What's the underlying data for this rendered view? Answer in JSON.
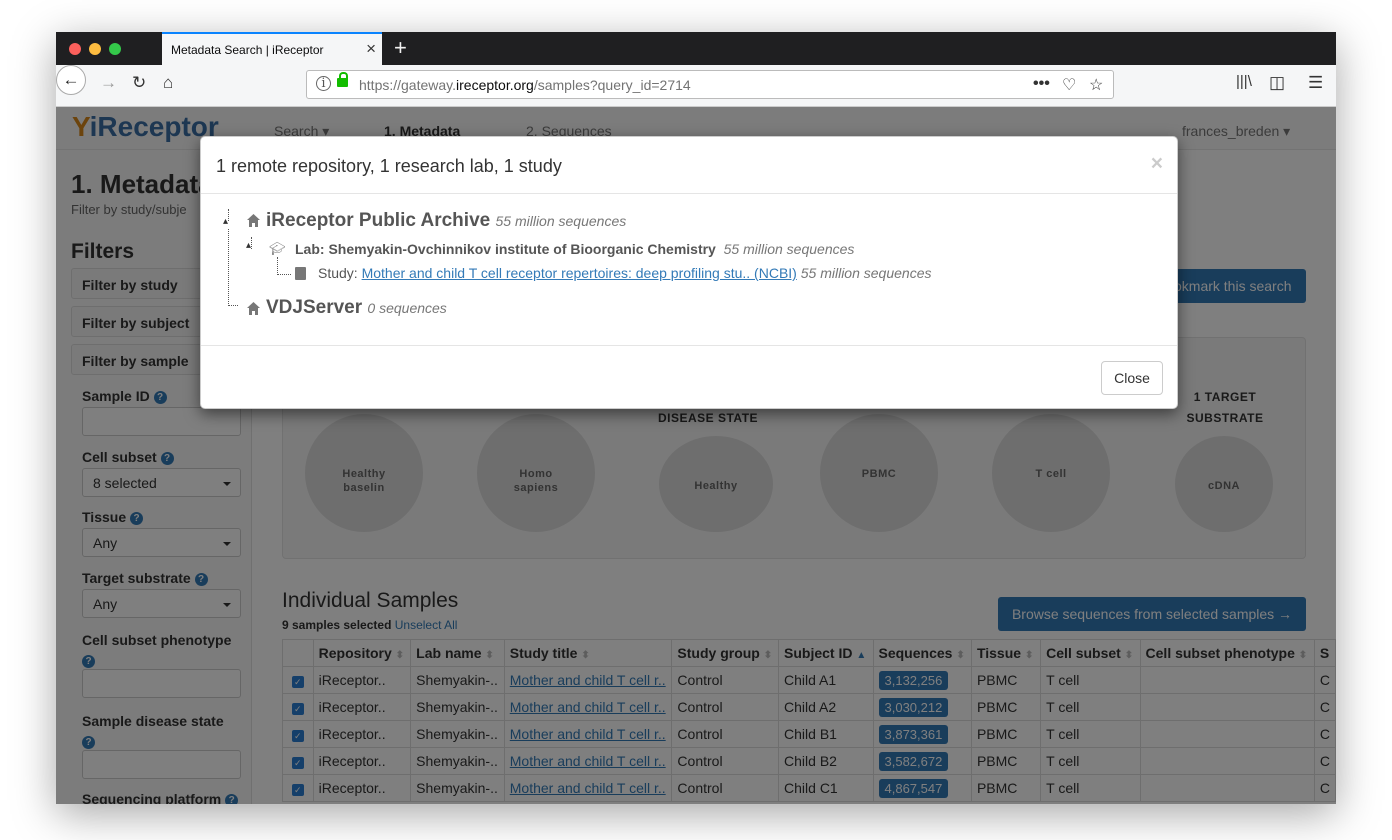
{
  "browser": {
    "tab_title": "Metadata Search | iReceptor",
    "url_prefix": "https://gateway.",
    "url_domain": "ireceptor.org",
    "url_path": "/samples?query_id=2714"
  },
  "site": {
    "logo_text": "iReceptor",
    "nav": {
      "search": "Search",
      "metadata": "1. Metadata",
      "sequences": "2. Sequences",
      "user": "frances_breden"
    },
    "page_title": "1. Metadata",
    "page_subtitle": "Filter by study/subje",
    "bookmark_button": "okmark this search"
  },
  "sidebar": {
    "heading": "Filters",
    "groups": [
      "Filter by study",
      "Filter by subject",
      "Filter by sample"
    ],
    "fields": {
      "sample_id": "Sample ID",
      "cell_subset": "Cell subset",
      "cell_subset_value": "8 selected",
      "tissue": "Tissue",
      "tissue_value": "Any",
      "target_substrate": "Target substrate",
      "target_substrate_value": "Any",
      "cell_subset_phenotype": "Cell subset phenotype",
      "sample_disease_state": "Sample disease state",
      "sequencing_platform": "Sequencing platform"
    }
  },
  "stats": {
    "headers": {
      "disease_state": "DISEASE STATE",
      "target_substrate_1": "1 TARGET",
      "target_substrate_2": "SUBSTRATE"
    },
    "bubbles": [
      {
        "line1": "Healthy",
        "line2": "baselin"
      },
      {
        "line1": "Homo",
        "line2": "sapiens"
      },
      {
        "line1": "Healthy",
        "line2": ""
      },
      {
        "line1": "PBMC",
        "line2": ""
      },
      {
        "line1": "T cell",
        "line2": ""
      },
      {
        "line1": "cDNA",
        "line2": ""
      }
    ]
  },
  "samples": {
    "heading": "Individual Samples",
    "selected_text": "9 samples selected",
    "unselect_all": "Unselect All",
    "browse_button": "Browse sequences from selected samples →",
    "columns": [
      "Repository",
      "Lab name",
      "Study title",
      "Study group",
      "Subject ID",
      "Sequences",
      "Tissue",
      "Cell subset",
      "Cell subset phenotype",
      "S"
    ],
    "rows": [
      {
        "repository": "iReceptor..",
        "lab": "Shemyakin-..",
        "study": "Mother and child T cell r..",
        "group": "Control",
        "subject": "Child A1",
        "sequences": "3,132,256",
        "tissue": "PBMC",
        "cell_subset": "T cell",
        "phenotype": "",
        "s": "C"
      },
      {
        "repository": "iReceptor..",
        "lab": "Shemyakin-..",
        "study": "Mother and child T cell r..",
        "group": "Control",
        "subject": "Child A2",
        "sequences": "3,030,212",
        "tissue": "PBMC",
        "cell_subset": "T cell",
        "phenotype": "",
        "s": "C"
      },
      {
        "repository": "iReceptor..",
        "lab": "Shemyakin-..",
        "study": "Mother and child T cell r..",
        "group": "Control",
        "subject": "Child B1",
        "sequences": "3,873,361",
        "tissue": "PBMC",
        "cell_subset": "T cell",
        "phenotype": "",
        "s": "C"
      },
      {
        "repository": "iReceptor..",
        "lab": "Shemyakin-..",
        "study": "Mother and child T cell r..",
        "group": "Control",
        "subject": "Child B2",
        "sequences": "3,582,672",
        "tissue": "PBMC",
        "cell_subset": "T cell",
        "phenotype": "",
        "s": "C"
      },
      {
        "repository": "iReceptor..",
        "lab": "Shemyakin-..",
        "study": "Mother and child T cell r..",
        "group": "Control",
        "subject": "Child C1",
        "sequences": "4,867,547",
        "tissue": "PBMC",
        "cell_subset": "T cell",
        "phenotype": "",
        "s": "C"
      }
    ]
  },
  "modal": {
    "title": "1 remote repository, 1 research lab, 1 study",
    "repo1_name": "iReceptor Public Archive",
    "repo1_count": "55 million sequences",
    "lab_name": "Lab: Shemyakin-Ovchinnikov institute of Bioorganic Chemistry",
    "lab_count": "55 million sequences",
    "study_prefix": "Study:",
    "study_link": "Mother and child T cell receptor repertoires: deep profiling stu.. (NCBI)",
    "study_count": "55 million sequences",
    "repo2_name": "VDJServer",
    "repo2_count": "0 sequences",
    "close_label": "Close",
    "close_x": "×"
  }
}
